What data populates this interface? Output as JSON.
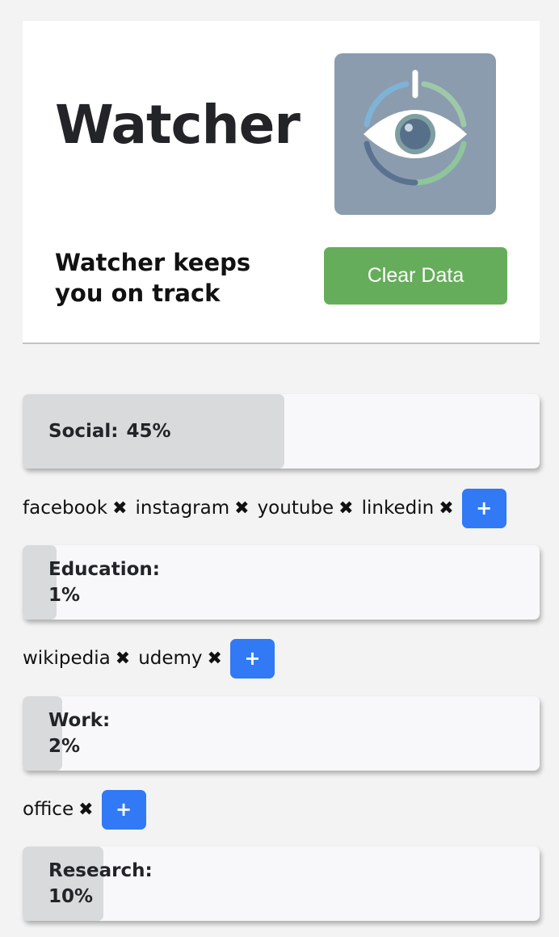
{
  "header": {
    "title": "Watcher",
    "tagline": "Watcher keeps you on track",
    "clear_button": "Clear Data",
    "logo_icon": "eye-icon"
  },
  "colors": {
    "clear_button": "#66ad5b",
    "add_button": "#3179f5",
    "bar_fill": "#d9dadc",
    "logo_background": "#8b9caf"
  },
  "categories": [
    {
      "name": "Social",
      "percent": 45,
      "label": "Social:",
      "percent_text": "45%",
      "sites": [
        "facebook",
        "instagram",
        "youtube",
        "linkedin"
      ],
      "add_label": "+"
    },
    {
      "name": "Education",
      "percent": 1,
      "label": "Education:",
      "percent_text": "1%",
      "sites": [
        "wikipedia",
        "udemy"
      ],
      "add_label": "+"
    },
    {
      "name": "Work",
      "percent": 2,
      "label": "Work:",
      "percent_text": "2%",
      "sites": [
        "office"
      ],
      "add_label": "+"
    },
    {
      "name": "Research",
      "percent": 10,
      "label": "Research:",
      "percent_text": "10%",
      "sites": [],
      "add_label": "+"
    }
  ],
  "remove_glyph": "✖"
}
